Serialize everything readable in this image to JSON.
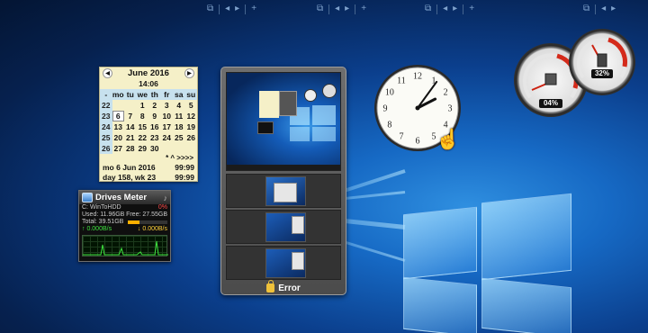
{
  "calendar": {
    "month": "June 2016",
    "time": "14:06",
    "headers": [
      "-",
      "mo",
      "tu",
      "we",
      "th",
      "fr",
      "sa",
      "su"
    ],
    "weeks": [
      [
        "22",
        "",
        "",
        "1",
        "2",
        "3",
        "4",
        "5"
      ],
      [
        "23",
        "6",
        "7",
        "8",
        "9",
        "10",
        "11",
        "12"
      ],
      [
        "24",
        "13",
        "14",
        "15",
        "16",
        "17",
        "18",
        "19"
      ],
      [
        "25",
        "20",
        "21",
        "22",
        "23",
        "24",
        "25",
        "26"
      ],
      [
        "26",
        "27",
        "28",
        "29",
        "30",
        "",
        "",
        ""
      ]
    ],
    "nav": "*   ^   >>>>",
    "date_line": "mo 6 Jun 2016",
    "date_value": "99:99",
    "day_line": "day 158, wk 23",
    "day_value": "99:99"
  },
  "drives": {
    "title": "Drives Meter",
    "drive": "C: WinToHDD",
    "drive_pct": "0%",
    "used": "Used: 11.96GB",
    "free": "Free: 27.55GB",
    "total": "Total: 39.51GB",
    "usage_fraction": 0.3,
    "read": "0.000B/s",
    "write": "0.000B/s"
  },
  "switcher": {
    "status": "Error"
  },
  "clock": {
    "hour": 2,
    "minute": 6,
    "numbers": [
      "12",
      "1",
      "2",
      "3",
      "4",
      "5",
      "6",
      "7",
      "8",
      "9",
      "10",
      "11"
    ]
  },
  "meters": {
    "cpu": "04%",
    "ram": "32%"
  },
  "icons": {
    "top_controls": [
      "restore-icon",
      "prev-icon",
      "next-icon",
      "add-icon"
    ]
  },
  "colors": {
    "desktop_blue": "#0b3f8d",
    "calendar_bg": "#f5f0c8",
    "meter_red": "#d42a1a"
  }
}
